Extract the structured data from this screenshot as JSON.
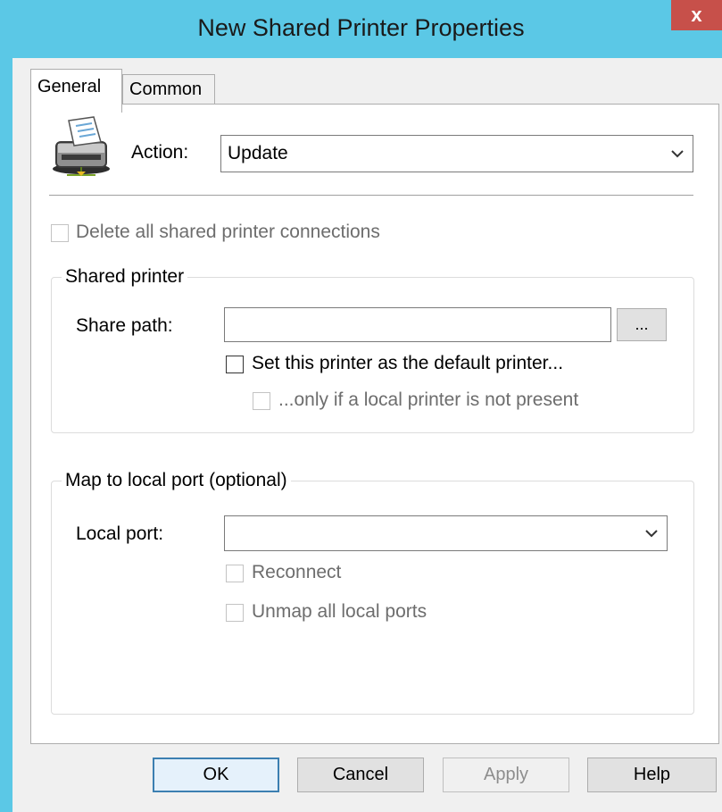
{
  "window": {
    "title": "New Shared Printer Properties",
    "close_label": "x"
  },
  "tabs": [
    {
      "label": "General",
      "selected": true
    },
    {
      "label": "Common",
      "selected": false
    }
  ],
  "general": {
    "action_label": "Action:",
    "action_value": "Update",
    "delete_all_label": "Delete all shared printer connections",
    "shared_printer": {
      "title": "Shared printer",
      "share_path_label": "Share path:",
      "share_path_value": "",
      "browse_label": "...",
      "set_default_label": "Set this printer as the default printer...",
      "only_if_label": "...only if a local printer is not present"
    },
    "map_port": {
      "title": "Map to local port (optional)",
      "local_port_label": "Local port:",
      "local_port_value": "",
      "reconnect_label": "Reconnect",
      "unmap_label": "Unmap all local ports"
    }
  },
  "buttons": {
    "ok": "OK",
    "cancel": "Cancel",
    "apply": "Apply",
    "help": "Help"
  },
  "colors": {
    "titlebar": "#5bc8e6",
    "close": "#c7504a",
    "default_button_border": "#3c7fb1"
  }
}
